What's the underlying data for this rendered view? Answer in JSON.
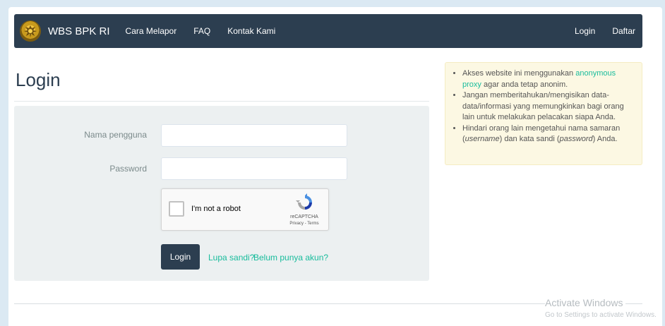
{
  "navbar": {
    "brand": "WBS BPK RI",
    "links": [
      "Cara Melapor",
      "FAQ",
      "Kontak Kami"
    ],
    "right_links": [
      "Login",
      "Daftar"
    ]
  },
  "page": {
    "title": "Login"
  },
  "form": {
    "username_label": "Nama pengguna",
    "password_label": "Password",
    "username_value": "",
    "password_value": "",
    "recaptcha": {
      "text": "I'm not a robot",
      "brand": "reCAPTCHA",
      "terms": "Privacy - Terms"
    },
    "login_button": "Login",
    "forgot_link": "Lupa sandi?",
    "register_link": "Belum punya akun?"
  },
  "info": {
    "item1_pre": "Akses website ini menggunakan ",
    "item1_link": "anonymous proxy",
    "item1_post": " agar anda tetap anonim.",
    "item2": "Jangan memberitahukan/mengisikan data-data/informasi yang memungkinkan bagi orang lain untuk melakukan pelacakan siapa Anda.",
    "item3_pre": "Hindari orang lain mengetahui nama samaran (",
    "item3_em1": "username",
    "item3_mid": ") dan kata sandi (",
    "item3_em2": "password",
    "item3_post": ") Anda."
  },
  "watermark": {
    "title": "Activate Windows",
    "subtitle": "Go to Settings to activate Windows."
  },
  "colors": {
    "navbar": "#2c3e50",
    "link": "#18bc9c",
    "panel": "#ecf0f1",
    "info_bg": "#fcf8e3"
  }
}
